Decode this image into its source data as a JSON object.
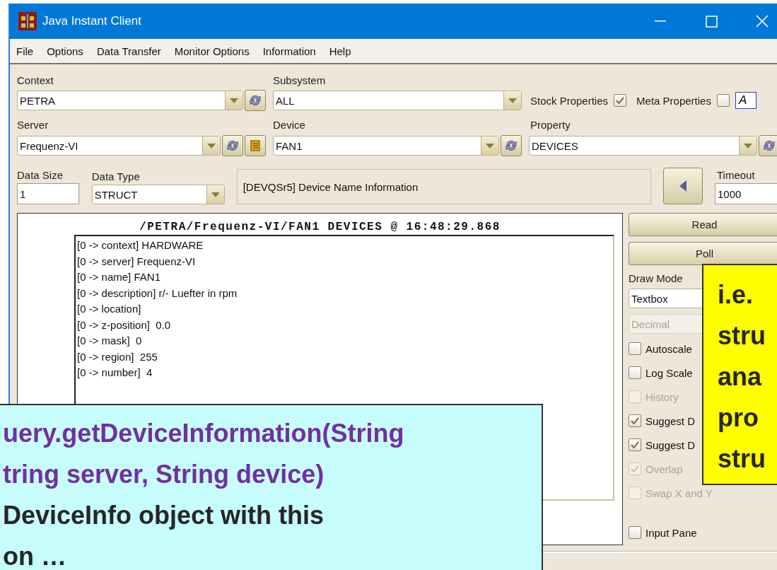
{
  "window": {
    "title": "Java Instant Client"
  },
  "menu": [
    "File",
    "Options",
    "Data Transfer",
    "Monitor Options",
    "Information",
    "Help"
  ],
  "context": {
    "label": "Context",
    "value": "PETRA"
  },
  "subsystem": {
    "label": "Subsystem",
    "value": "ALL"
  },
  "stock_properties": {
    "label": "Stock Properties",
    "checked": true
  },
  "meta_properties": {
    "label": "Meta Properties",
    "checked": false
  },
  "font_button": "A",
  "server": {
    "label": "Server",
    "value": "Frequenz-VI"
  },
  "device": {
    "label": "Device",
    "value": "FAN1"
  },
  "property": {
    "label": "Property",
    "value": "DEVICES"
  },
  "data_size": {
    "label": "Data Size",
    "value": "1"
  },
  "data_type": {
    "label": "Data Type",
    "value": "STRUCT"
  },
  "info": "[DEVQSr5] Device Name Information",
  "timeout": {
    "label": "Timeout",
    "value": "1000"
  },
  "output": {
    "header": "/PETRA/Frequenz-VI/FAN1 DEVICES @ 16:48:29.868",
    "lines": [
      "[0 -> context] HARDWARE",
      "[0 -> server] Frequenz-VI",
      "[0 -> name] FAN1",
      "[0 -> description] r/- Luefter in rpm",
      "[0 -> location]",
      "[0 -> z-position]  0.0",
      "[0 -> mask]  0",
      "[0 -> region]  255",
      "[0 -> number]  4"
    ]
  },
  "side": {
    "buttons": [
      "Read",
      "Poll"
    ],
    "draw_mode": {
      "label": "Draw Mode",
      "value": "Textbox"
    },
    "format": {
      "value": "Decimal",
      "disabled": true
    },
    "options": [
      {
        "label": "Autoscale",
        "checked": false,
        "disabled": false
      },
      {
        "label": "Log Scale",
        "checked": false,
        "disabled": false
      },
      {
        "label": "History",
        "checked": false,
        "disabled": true
      },
      {
        "label": "Suggest D",
        "checked": true,
        "disabled": false
      },
      {
        "label": "Suggest D",
        "checked": true,
        "disabled": false
      },
      {
        "label": "Overlap",
        "checked": true,
        "disabled": true
      },
      {
        "label": "Swap X and Y",
        "checked": false,
        "disabled": true
      }
    ],
    "input_pane": {
      "label": "Input Pane",
      "checked": false
    }
  },
  "callouts": [
    {
      "kind": "method",
      "lines": [
        {
          "text": "uery.getDeviceInformation(String",
          "kind": "code"
        },
        {
          "text": "tring server, String device)",
          "kind": "code"
        },
        {
          "text": "DeviceInfo object with this",
          "kind": "plain"
        },
        {
          "text": "on …",
          "kind": "plain"
        }
      ]
    },
    {
      "kind": "remark",
      "lines": [
        {
          "text": "i.e.",
          "kind": "plain"
        },
        {
          "text": "stru",
          "kind": "plain"
        },
        {
          "text": "ana",
          "kind": "plain"
        },
        {
          "text": "pro",
          "kind": "plain"
        },
        {
          "text": "stru",
          "kind": "plain"
        }
      ]
    }
  ]
}
